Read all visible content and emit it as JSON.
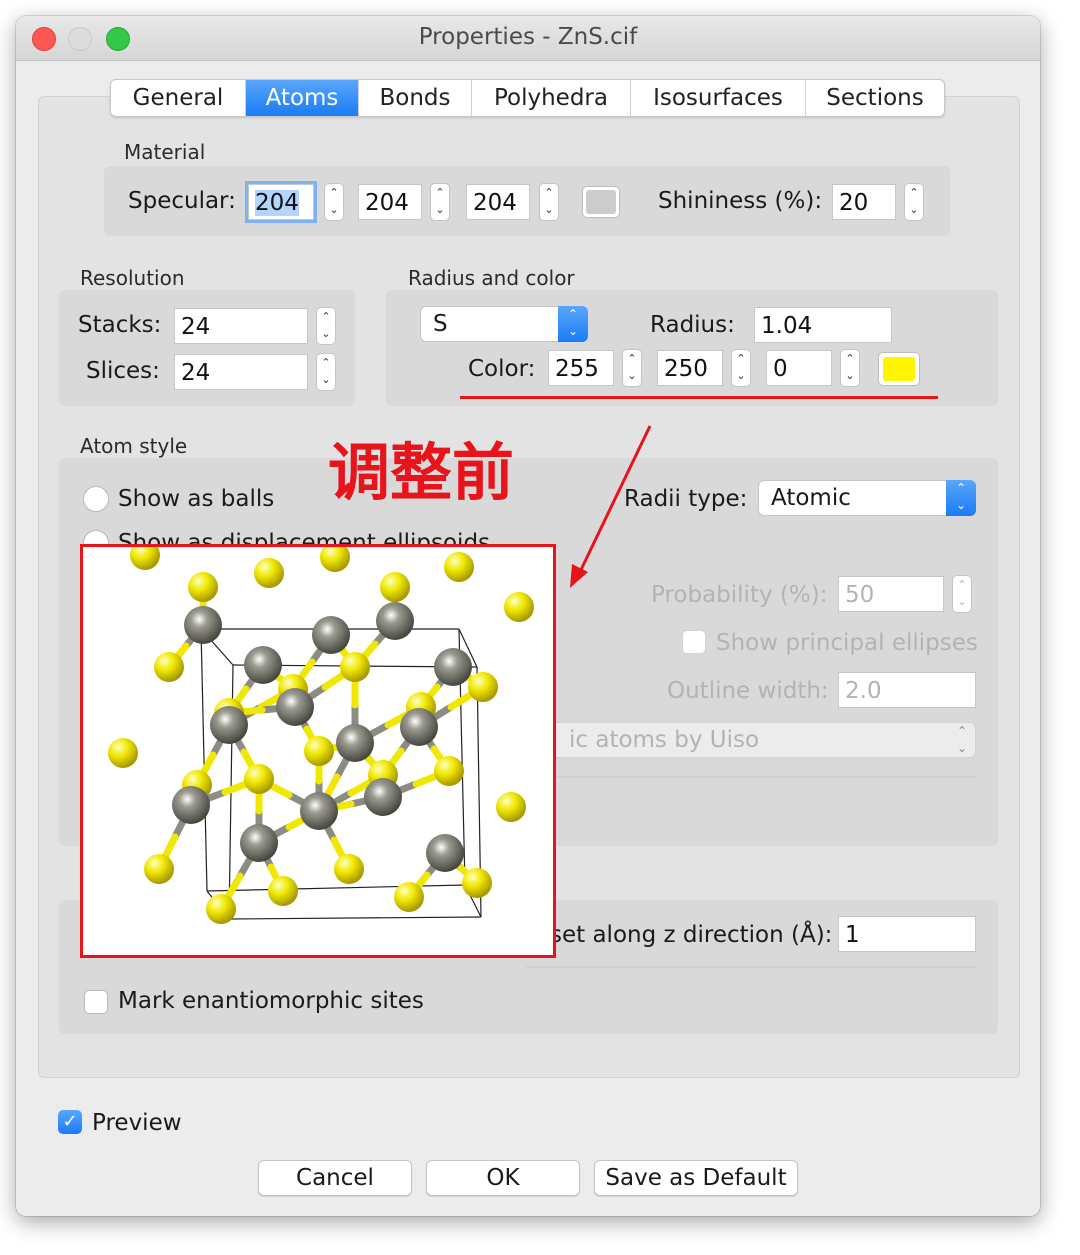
{
  "window": {
    "title": "Properties - ZnS.cif"
  },
  "tabs": [
    {
      "label": "General"
    },
    {
      "label": "Atoms"
    },
    {
      "label": "Bonds"
    },
    {
      "label": "Polyhedra"
    },
    {
      "label": "Isosurfaces"
    },
    {
      "label": "Sections"
    }
  ],
  "material": {
    "heading": "Material",
    "specular_label": "Specular:",
    "specular": [
      "204",
      "204",
      "204"
    ],
    "shininess_label": "Shininess (%):",
    "shininess": "20"
  },
  "resolution": {
    "heading": "Resolution",
    "stacks_label": "Stacks:",
    "stacks": "24",
    "slices_label": "Slices:",
    "slices": "24"
  },
  "radius_color": {
    "heading": "Radius and color",
    "element": "S",
    "radius_label": "Radius:",
    "radius": "1.04",
    "color_label": "Color:",
    "rgb": [
      "255",
      "250",
      "0"
    ],
    "swatch_color": "#fff500"
  },
  "atom_style": {
    "heading": "Atom style",
    "show_balls": "Show as balls",
    "show_ellipsoids": "Show as displacement ellipsoids",
    "radii_label": "Radii type:",
    "radii_value": "Atomic",
    "probability_label": "Probability (%):",
    "probability": "50",
    "principal": "Show principal ellipses",
    "outline_label": "Outline width:",
    "outline": "2.0",
    "iso_text": "ic atoms by Uiso"
  },
  "offset": {
    "label": "set along z direction (Å):",
    "value": "1"
  },
  "mark_enantiomorphic": "Mark enantiomorphic sites",
  "annotation": "调整前",
  "preview": "Preview",
  "buttons": {
    "cancel": "Cancel",
    "ok": "OK",
    "save_default": "Save as Default"
  },
  "colors": {
    "accent": "#1a7cf5",
    "annotation_red": "#e8141b",
    "sulfur": "#f0e800",
    "zinc": "#7a7a70"
  }
}
